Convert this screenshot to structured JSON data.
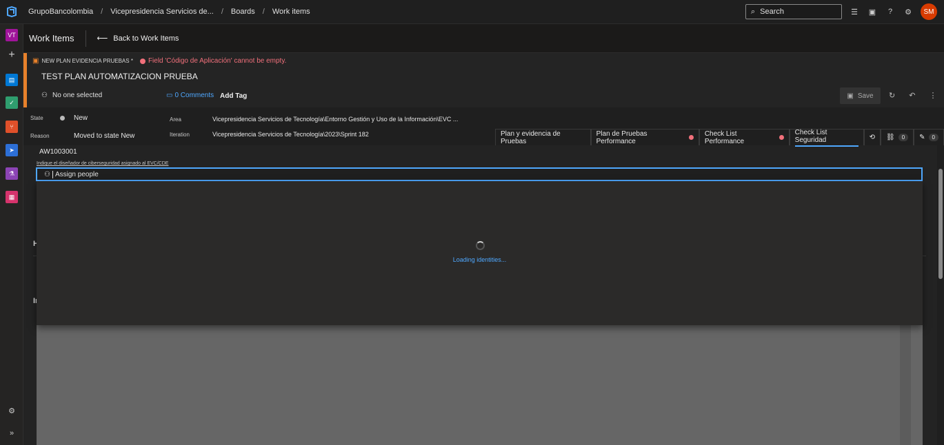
{
  "breadcrumbs": [
    "GrupoBancolombia",
    "Vicepresidencia Servicios de...",
    "Boards",
    "Work items"
  ],
  "search": {
    "placeholder": "Search"
  },
  "user": {
    "initials": "SM",
    "color": "#d83b01"
  },
  "project": {
    "initials": "VT"
  },
  "header": {
    "title": "Work Items",
    "back_label": "Back to Work Items"
  },
  "workitem": {
    "type_label": "NEW PLAN EVIDENCIA PRUEBAS *",
    "error": "Field 'Código de Aplicación' cannot be empty.",
    "title": "TEST PLAN AUTOMATIZACION PRUEBA",
    "assigned": "No one selected",
    "comments": "0 Comments",
    "add_tag": "Add Tag",
    "save": "Save"
  },
  "fields": {
    "state_label": "State",
    "state_value": "New",
    "reason_label": "Reason",
    "reason_value": "Moved to state New",
    "area_label": "Area",
    "area_value": "Vicepresidencia Servicios de Tecnología\\Entorno Gestión y Uso de la Información\\EVC ...",
    "iteration_label": "Iteration",
    "iteration_value": "Vicepresidencia Servicios de Tecnología\\2023\\Sprint 182"
  },
  "tabs": [
    {
      "label": "Plan y evidencia de Pruebas",
      "error": false
    },
    {
      "label": "Plan de Pruebas Performance",
      "error": true
    },
    {
      "label": "Check List Performance",
      "error": true
    },
    {
      "label": "Check List Seguridad",
      "active": true
    }
  ],
  "counts": {
    "links": "0",
    "attachments": "0"
  },
  "body": {
    "app_id": "AW1003001",
    "hint": "Indique el diseñador de ciberseguridad asignado al EVC/CDE",
    "assign_placeholder": "Assign people",
    "loading": "Loading identities...",
    "section_h": "H",
    "section_i": "In"
  },
  "colors": {
    "accent": "#4fa8ff",
    "error": "#f1707b",
    "type_bar": "#e8812b"
  }
}
